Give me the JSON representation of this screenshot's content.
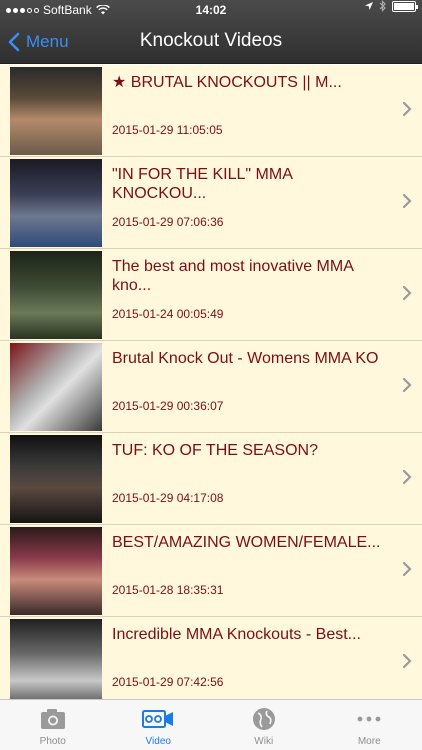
{
  "status_bar": {
    "carrier": "SoftBank",
    "time": "14:02"
  },
  "nav": {
    "back_label": "Menu",
    "title": "Knockout Videos"
  },
  "videos": [
    {
      "title": "★ BRUTAL KNOCKOUTS || M...",
      "date": "2015-01-29 11:05:05"
    },
    {
      "title": "\"IN FOR THE KILL\" MMA KNOCKOU...",
      "date": "2015-01-29 07:06:36"
    },
    {
      "title": "The best and most inovative MMA kno...",
      "date": "2015-01-24 00:05:49"
    },
    {
      "title": "Brutal Knock Out - Womens MMA KO",
      "date": "2015-01-29 00:36:07"
    },
    {
      "title": "TUF:  KO OF THE SEASON?",
      "date": "2015-01-29 04:17:08"
    },
    {
      "title": "BEST/AMAZING WOMEN/FEMALE...",
      "date": "2015-01-28 18:35:31"
    },
    {
      "title": "Incredible MMA Knockouts - Best...",
      "date": "2015-01-29 07:42:56"
    }
  ],
  "tabs": [
    {
      "label": "Photo",
      "icon": "camera-icon"
    },
    {
      "label": "Video",
      "icon": "video-camera-icon",
      "active": true
    },
    {
      "label": "Wiki",
      "icon": "globe-icon"
    },
    {
      "label": "More",
      "icon": "more-dots-icon"
    }
  ],
  "colors": {
    "accent": "#1b7be8",
    "title_text": "#7a0f14",
    "row_background": "#fff8dc",
    "header": "#3a3a3a"
  }
}
